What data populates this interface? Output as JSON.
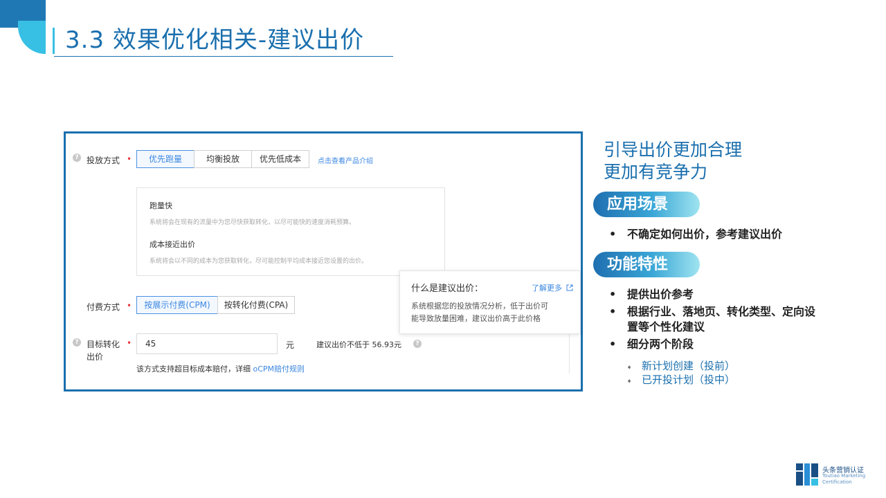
{
  "slide": {
    "title": "3.3 效果优化相关-建议出价"
  },
  "ad_form": {
    "delivery": {
      "label": "投放方式",
      "options": [
        "优先跑量",
        "均衡投放",
        "优先低成本"
      ],
      "selected": "优先跑量",
      "intro_link": "点击查看产品介绍"
    },
    "info_panel": {
      "item1_title": "跑量快",
      "item1_desc": "系统将会在现有的流量中为您尽快获取转化，以尽可能快的速度消耗预算。",
      "item2_title": "成本接近出价",
      "item2_desc": "系统将会以不同的成本为您获取转化，尽可能控制平均成本接近您设置的出价。"
    },
    "payment": {
      "label": "付费方式",
      "options": [
        "按展示付费(CPM)",
        "按转化付费(CPA)"
      ],
      "selected": "按展示付费(CPM)"
    },
    "target": {
      "label_line1": "目标转化",
      "label_line2": "出价",
      "value": "45",
      "unit": "元",
      "suggest": "建议出价不低于 56.93元",
      "note": "该方式支持超目标成本赔付，详细",
      "note_link": "oCPM赔付规则"
    },
    "tooltip": {
      "title": "什么是建议出价：",
      "more": "了解更多",
      "body_line1": "系统根据您的投放情况分析，低于出价可",
      "body_line2": "能导致放量困难，建议出价高于此价格"
    }
  },
  "right": {
    "headline_line1": "引导出价更加合理",
    "headline_line2": "更加有竞争力",
    "scene_tag": "应用场景",
    "scene_bullet": "不确定如何出价，参考建议出价",
    "feature_tag": "功能特性",
    "feature_bullets": [
      "提供出价参考",
      "根据行业、落地页、转化类型、定向设",
      "置等个性化建议",
      "细分两个阶段"
    ],
    "sub_items": [
      "新计划创建（投前）",
      "已开投计划（投中）"
    ]
  },
  "logo": {
    "cn": "头条营销认证",
    "en_line1": "Toutiao Marketing",
    "en_line2": "Certification"
  },
  "colors": {
    "brand_blue": "#1a6fae",
    "accent_cyan": "#37c0e3",
    "link_blue": "#3a86e0",
    "required_red": "#e4393c"
  }
}
